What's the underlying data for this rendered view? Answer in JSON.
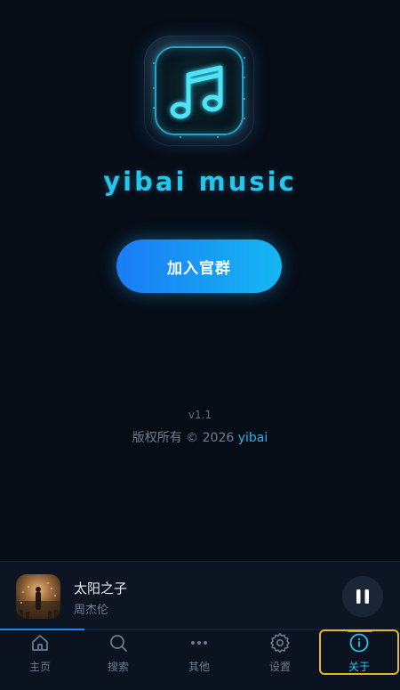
{
  "app": {
    "name": "yibai music",
    "join_button_label": "加入官群",
    "version": "v1.1",
    "copyright_prefix": "版权所有 © 2026",
    "copyright_author": "yibai"
  },
  "player": {
    "song_title": "太阳之子",
    "artist": "周杰伦",
    "progress": 0.21,
    "state_icon": "pause-icon"
  },
  "nav": {
    "items": [
      {
        "label": "主页",
        "icon": "home-icon"
      },
      {
        "label": "搜索",
        "icon": "search-icon"
      },
      {
        "label": "其他",
        "icon": "more-icon"
      },
      {
        "label": "设置",
        "icon": "gear-icon"
      },
      {
        "label": "关于",
        "icon": "info-icon"
      }
    ],
    "active_index": 4
  },
  "colors": {
    "background": "#070d17",
    "accent": "#27c4ec",
    "button_gradient_start": "#1a7cf5",
    "button_gradient_end": "#15b6f4",
    "muted_text": "#6d7d91",
    "highlight_border": "#e7b52a"
  }
}
